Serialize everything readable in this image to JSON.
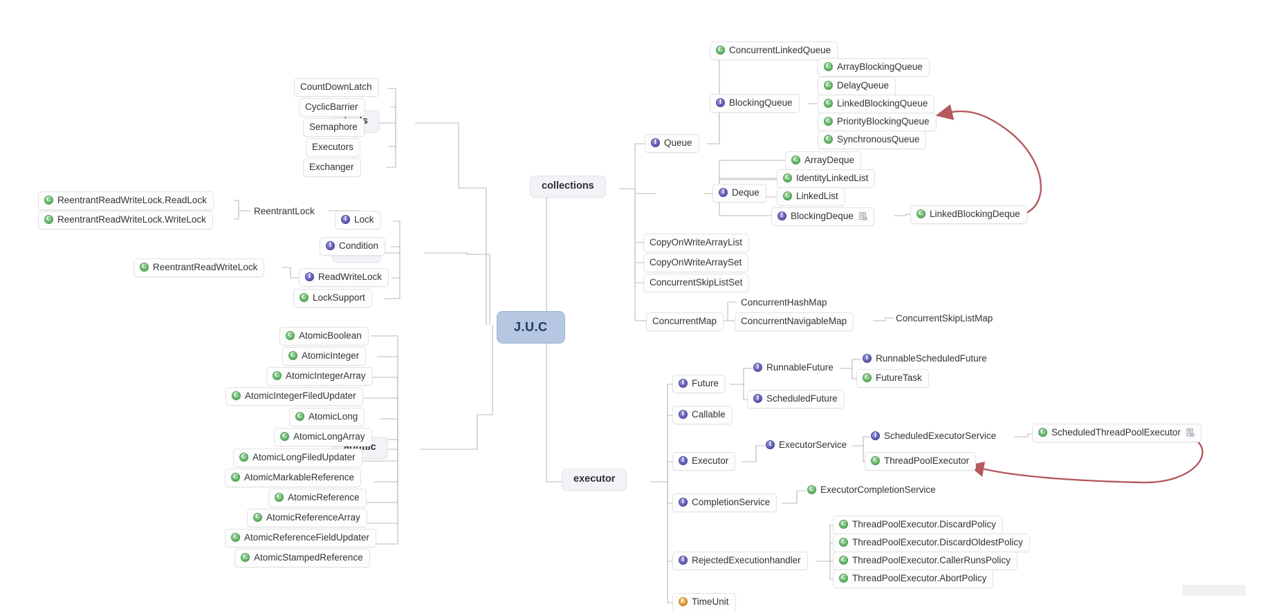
{
  "root": {
    "label": "J.U.C"
  },
  "branches": {
    "tools": "tools",
    "locks": "locks",
    "aotmic": "aotmic",
    "collections": "collections",
    "executor": "executor"
  },
  "tools_items": [
    {
      "label": "CountDownLatch",
      "icon": "none"
    },
    {
      "label": "CyclicBarrier",
      "icon": "none"
    },
    {
      "label": "Semaphore",
      "icon": "none"
    },
    {
      "label": "Executors",
      "icon": "none"
    },
    {
      "label": "Exchanger",
      "icon": "none"
    }
  ],
  "locks_items": [
    {
      "label": "Lock",
      "icon": "interface"
    },
    {
      "label": "Condition",
      "icon": "interface"
    },
    {
      "label": "ReadWriteLock",
      "icon": "interface"
    },
    {
      "label": "LockSupport",
      "icon": "class"
    }
  ],
  "locks_lock_children": [
    {
      "label": "ReentrantLock",
      "icon": "none"
    }
  ],
  "locks_reentrantlock_children": [
    {
      "label": "ReentrantReadWriteLock.ReadLock",
      "icon": "class"
    },
    {
      "label": "ReentrantReadWriteLock.WriteLock",
      "icon": "class"
    }
  ],
  "locks_rwlock_children": [
    {
      "label": "ReentrantReadWriteLock",
      "icon": "class"
    }
  ],
  "atomic_items": [
    {
      "label": "AtomicBoolean",
      "icon": "class"
    },
    {
      "label": "AtomicInteger",
      "icon": "class"
    },
    {
      "label": "AtomicIntegerArray",
      "icon": "class"
    },
    {
      "label": "AtomicIntegerFiledUpdater",
      "icon": "class"
    },
    {
      "label": "AtomicLong",
      "icon": "class"
    },
    {
      "label": "AtomicLongArray",
      "icon": "class"
    },
    {
      "label": "AtomicLongFiledUpdater",
      "icon": "class"
    },
    {
      "label": "AtomicMarkableReference",
      "icon": "class"
    },
    {
      "label": "AtomicReference",
      "icon": "class"
    },
    {
      "label": "AtomicReferenceArray",
      "icon": "class"
    },
    {
      "label": "AtomicReferenceFieldUpdater",
      "icon": "class"
    },
    {
      "label": "AtomicStampedReference",
      "icon": "class"
    }
  ],
  "collections": {
    "queue": {
      "label": "Queue",
      "icon": "interface"
    },
    "deque": {
      "label": "Deque",
      "icon": "interface"
    },
    "queue_children": [
      {
        "label": "ConcurrentLinkedQueue",
        "icon": "class"
      },
      {
        "label": "BlockingQueue",
        "icon": "interface"
      }
    ],
    "blockingqueue_children": [
      {
        "label": "ArrayBlockingQueue",
        "icon": "class"
      },
      {
        "label": "DelayQueue",
        "icon": "class"
      },
      {
        "label": "LinkedBlockingQueue",
        "icon": "class"
      },
      {
        "label": "PriorityBlockingQueue",
        "icon": "class"
      },
      {
        "label": "SynchronousQueue",
        "icon": "class"
      }
    ],
    "deque_children": [
      {
        "label": "ArrayDeque",
        "icon": "class"
      },
      {
        "label": "IdentityLinkedList",
        "icon": "class"
      },
      {
        "label": "LinkedList",
        "icon": "class"
      },
      {
        "label": "BlockingDeque",
        "icon": "interface",
        "note": true
      }
    ],
    "blockingdeque_children": [
      {
        "label": "LinkedBlockingDeque",
        "icon": "class"
      }
    ],
    "lists": [
      {
        "label": "CopyOnWriteArrayList",
        "icon": "none"
      },
      {
        "label": "CopyOnWriteArraySet",
        "icon": "none"
      },
      {
        "label": "ConcurrentSkipListSet",
        "icon": "none"
      }
    ],
    "map": {
      "label": "ConcurrentMap",
      "icon": "none"
    },
    "map_children": [
      {
        "label": "ConcurrentHashMap",
        "icon": "none"
      },
      {
        "label": "ConcurrentNavigableMap",
        "icon": "none"
      }
    ],
    "navigablemap_children": [
      {
        "label": "ConcurrentSkipListMap",
        "icon": "none"
      }
    ]
  },
  "executor": {
    "items": [
      {
        "label": "Future",
        "icon": "interface"
      },
      {
        "label": "Callable",
        "icon": "interface"
      },
      {
        "label": "Executor",
        "icon": "interface"
      },
      {
        "label": "CompletionService",
        "icon": "interface"
      },
      {
        "label": "RejectedExecutionhandler",
        "icon": "interface"
      },
      {
        "label": "TimeUnit",
        "icon": "enum"
      }
    ],
    "future_children": [
      {
        "label": "RunnableFuture",
        "icon": "interface"
      },
      {
        "label": "ScheduledFuture",
        "icon": "interface"
      }
    ],
    "runnablefuture_children": [
      {
        "label": "RunnableScheduledFuture",
        "icon": "interface"
      },
      {
        "label": "FutureTask",
        "icon": "class"
      }
    ],
    "executor_children": [
      {
        "label": "ExecutorService",
        "icon": "interface"
      }
    ],
    "executorservice_children": [
      {
        "label": "ScheduledExecutorService",
        "icon": "interface"
      },
      {
        "label": "ThreadPoolExecutor",
        "icon": "class"
      }
    ],
    "scheduledexecutorservice_children": [
      {
        "label": "ScheduledThreadPoolExecutor",
        "icon": "class",
        "note": true
      }
    ],
    "completionservice_children": [
      {
        "label": "ExecutorCompletionService",
        "icon": "class"
      }
    ],
    "rejected_children": [
      {
        "label": "ThreadPoolExecutor.DiscardPolicy",
        "icon": "class"
      },
      {
        "label": "ThreadPoolExecutor.DiscardOldestPolicy",
        "icon": "class"
      },
      {
        "label": "ThreadPoolExecutor.CallerRunsPolicy",
        "icon": "class"
      },
      {
        "label": "ThreadPoolExecutor.AbortPolicy",
        "icon": "class"
      }
    ]
  },
  "colors": {
    "root_fill": "#b6c7e2",
    "branch_fill": "#f2f3f7",
    "class_icon": "#61b465",
    "interface_icon": "#5f5cb4",
    "enum_icon": "#e09a2e",
    "link": "#b8b8b8",
    "arrow": "#b5595f"
  }
}
